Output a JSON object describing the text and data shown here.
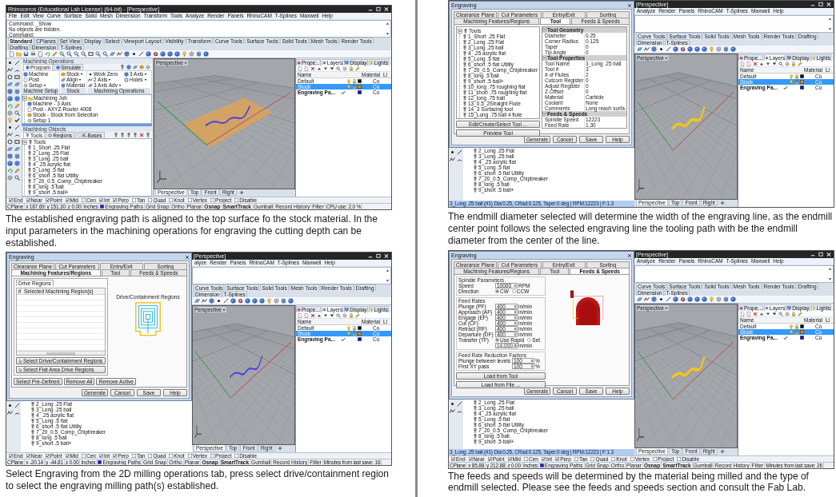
{
  "panels": [
    {
      "screenshot": {
        "title": "Rhinoceros (Educational Lab License) (64-bit) - [Perspective]",
        "menu": [
          "File",
          "Edit",
          "View",
          "Curve",
          "Surface",
          "Solid",
          "Mesh",
          "Dimension",
          "Transform",
          "Tools",
          "Analyze",
          "Render",
          "Panels",
          "RhinoCAM",
          "T-Splines",
          "Maxwell",
          "Help"
        ],
        "command_lines": [
          "Command: _Show",
          "No objects are hidden.",
          "Command:"
        ],
        "toolbar_tabs": [
          {
            "label": "Standard",
            "selected": true
          },
          {
            "label": "CPlanes",
            "selected": false
          },
          {
            "label": "Set View",
            "selected": false
          },
          {
            "label": "Display",
            "selected": false
          },
          {
            "label": "Select",
            "selected": false
          },
          {
            "label": "Viewport Layout",
            "selected": false
          },
          {
            "label": "Visibility",
            "selected": false
          },
          {
            "label": "Transform",
            "selected": false
          },
          {
            "label": "Curve Tools",
            "selected": false
          },
          {
            "label": "Surface Tools",
            "selected": false
          },
          {
            "label": "Solid Tools",
            "selected": false
          },
          {
            "label": "Mesh Tools",
            "selected": false
          },
          {
            "label": "Render Tools",
            "selected": false
          },
          {
            "label": "Drafting",
            "selected": false
          },
          {
            "label": "Dimension",
            "selected": false
          },
          {
            "label": "T-Splines",
            "selected": false
          }
        ],
        "ops_panel": {
          "title": "Machining Operations",
          "tabs": [
            {
              "label": "Program",
              "selected": true
            },
            {
              "label": "Simulate",
              "selected": false
            }
          ],
          "groups": [
            {
              "label": "Machine Setup",
              "buttons": [
                {
                  "label": "Machine",
                  "dropdown": false
                },
                {
                  "label": "Post",
                  "dropdown": false
                },
                {
                  "label": "Setup",
                  "dropdown": true
                }
              ]
            },
            {
              "label": "Stock",
              "buttons": [
                {
                  "label": "Stock",
                  "dropdown": true
                },
                {
                  "label": "Align",
                  "dropdown": true
                },
                {
                  "label": "Material",
                  "dropdown": false
                }
              ]
            },
            {
              "label": "Machining Operations",
              "buttons": [
                {
                  "label": "Work Zero",
                  "dropdown": false
                },
                {
                  "label": "2 Axis",
                  "dropdown": true
                },
                {
                  "label": "3 Axis Adv",
                  "dropdown": true
                },
                {
                  "label": "3 Axis",
                  "dropdown": true
                },
                {
                  "label": "Holes",
                  "dropdown": true
                }
              ]
            }
          ],
          "tree": {
            "label": "Machining Job",
            "expanded": true,
            "children": [
              {
                "label": "Machine - 3 Axis"
              },
              {
                "label": "Post - AXYZ-Router 4008"
              },
              {
                "label": "Stock - Stock from Selection"
              },
              {
                "label": "Setup 1"
              }
            ]
          }
        },
        "objects_panel": {
          "title": "Machining Objects",
          "tabs": [
            {
              "label": "Tools",
              "selected": true
            },
            {
              "label": "Regions",
              "selected": false
            },
            {
              "label": "K-Bases",
              "selected": false
            }
          ],
          "tree": {
            "label": "Tools",
            "expanded": true,
            "children": [
              {
                "label": "1_Short .25 Flat"
              },
              {
                "label": "2_Long .25 Flat"
              },
              {
                "label": "3_Long .25 ball"
              },
              {
                "label": "4_.25 acrylic flat"
              },
              {
                "label": "5_Long .5 flat"
              },
              {
                "label": "6_short .5 flat Utility"
              },
              {
                "label": "7_20_0.5_Comp_Chipbreaker"
              },
              {
                "label": "8_long .5 ball"
              },
              {
                "label": "9_short .5 ball+"
              }
            ]
          }
        },
        "viewport": {
          "label": "Perspective",
          "stock_visible": true,
          "curve_selected": false
        },
        "layers": {
          "tabs": [
            {
              "label": "Prope...",
              "selected": false
            },
            {
              "label": "Layers",
              "selected": true
            },
            {
              "label": "Display",
              "selected": false
            },
            {
              "label": "Lights",
              "selected": false
            }
          ],
          "columns": [
            "Name",
            "Material",
            "Li"
          ],
          "rows": [
            {
              "name": "Default",
              "selected": false,
              "current": false,
              "color": "#000000",
              "linetype": "Co"
            },
            {
              "name": "Stock",
              "selected": true,
              "current": false,
              "color": "#ff8c00",
              "linetype": "Co"
            },
            {
              "name": "Engraving Pa...",
              "selected": false,
              "current": true,
              "color": "#0000ff",
              "linetype": "Co"
            }
          ]
        },
        "viewport_tabs": [
          {
            "label": "Perspective",
            "selected": true
          },
          {
            "label": "Top",
            "selected": false
          },
          {
            "label": "Front",
            "selected": false
          },
          {
            "label": "Right",
            "selected": false
          }
        ],
        "osnap": [
          {
            "label": "End",
            "checked": true
          },
          {
            "label": "Near",
            "checked": true
          },
          {
            "label": "Point",
            "checked": true
          },
          {
            "label": "Mid",
            "checked": true
          },
          {
            "label": "Cen",
            "checked": false
          },
          {
            "label": "Int",
            "checked": true
          },
          {
            "label": "Perp",
            "checked": true
          },
          {
            "label": "Tan",
            "checked": false
          },
          {
            "label": "Quad",
            "checked": false
          },
          {
            "label": "Knot",
            "checked": false
          },
          {
            "label": "Vertex",
            "checked": false
          },
          {
            "label": "Project",
            "checked": false
          },
          {
            "label": "Disable",
            "checked": false
          }
        ],
        "status": [
          {
            "kind": "text",
            "text": "CPlane"
          },
          {
            "kind": "text",
            "text": "x 187.69"
          },
          {
            "kind": "text",
            "text": "y 151.30"
          },
          {
            "kind": "text",
            "text": "z 0.00"
          },
          {
            "kind": "text",
            "text": "Inches"
          },
          {
            "kind": "layer",
            "text": "Engraving Paths"
          },
          {
            "kind": "toggle",
            "text": "Grid Snap",
            "on": false
          },
          {
            "kind": "toggle",
            "text": "Ortho",
            "on": false
          },
          {
            "kind": "toggle",
            "text": "Planar",
            "on": false
          },
          {
            "kind": "toggle",
            "text": "Osnap",
            "on": true
          },
          {
            "kind": "toggle",
            "text": "SmartTrack",
            "on": true
          },
          {
            "kind": "toggle",
            "text": "Gumball",
            "on": false
          },
          {
            "kind": "toggle",
            "text": "Record History",
            "on": false
          },
          {
            "kind": "toggle",
            "text": "Filter",
            "on": false
          },
          {
            "kind": "text",
            "text": "CPU use: 2.0 %"
          }
        ]
      },
      "caption": "The established engraving path is aligned to the top surface fo the stock material. In the input parameters in the machining operations for engraving the cutting depth can be established."
    },
    {
      "screenshot": {
        "title": "[Perspective]",
        "menu": [
          "alyze",
          "Render",
          "Panels",
          "RhinoCAM",
          "T-Splines",
          "Maxwell",
          "Help"
        ],
        "toolbar_tabs": [
          {
            "label": "Curve Tools",
            "selected": false
          },
          {
            "label": "Surface Tools",
            "selected": false
          },
          {
            "label": "Solid Tools",
            "selected": false
          },
          {
            "label": "Mesh Tools",
            "selected": false
          },
          {
            "label": "Render Tools",
            "selected": false
          },
          {
            "label": "Drafting",
            "selected": false
          },
          {
            "label": "Dimension",
            "selected": false
          },
          {
            "label": "T-Splines",
            "selected": false
          }
        ],
        "dialog": {
          "title": "Engraving",
          "tab_rows": [
            [
              {
                "label": "Clearance Plane",
                "selected": false
              },
              {
                "label": "Cut Parameters",
                "selected": false
              },
              {
                "label": "Entry/Exit",
                "selected": false
              },
              {
                "label": "Sorting",
                "selected": false
              }
            ],
            [
              {
                "label": "Machining Features/Regions",
                "selected": true
              },
              {
                "label": "Tool",
                "selected": false
              },
              {
                "label": "Feeds & Speeds",
                "selected": false
              }
            ]
          ],
          "page": {
            "kind": "regions",
            "group": "Drive Regions",
            "columns": [
              "#",
              "Selected Machining Region(s)"
            ],
            "diagram_label": "Drive/Containment Regions",
            "select_buttons": [
              "Select Drive/Containment Regions",
              "Select Flat Area Drive Regions"
            ],
            "action_buttons": [
              "Select Pre-Defined",
              "Remove All",
              "Remove Active"
            ]
          },
          "buttons": [
            "Generate",
            "Cancel",
            "Save",
            "Help"
          ]
        },
        "tools_list": [
          "2_Long .25 Flat",
          "3_Long .25 ball",
          "4_.25 acrylic flat",
          "5_Long .5 flat",
          "6_short .5 flat Utility",
          "7_20_0.5_Comp_Chipbreaker",
          "8_long .5 ball",
          "9_short .5 ball+"
        ],
        "viewport": {
          "label": "Perspective",
          "stock_visible": false,
          "curve_selected": false
        },
        "layers": {
          "tabs": [
            {
              "label": "Prope...",
              "selected": false
            },
            {
              "label": "Layers",
              "selected": true
            },
            {
              "label": "Display",
              "selected": false
            },
            {
              "label": "Lights",
              "selected": false
            }
          ],
          "columns": [
            "Name",
            "Material",
            "Li"
          ],
          "rows": [
            {
              "name": "Default",
              "selected": false,
              "current": false,
              "color": "#000000",
              "linetype": "Co"
            },
            {
              "name": "Stock",
              "selected": true,
              "current": false,
              "color": "#ff8c00",
              "linetype": "Co"
            },
            {
              "name": "Engraving Pa...",
              "selected": false,
              "current": true,
              "color": "#0000ff",
              "linetype": "Co"
            }
          ]
        },
        "viewport_tabs": [
          {
            "label": "Perspective",
            "selected": true
          },
          {
            "label": "Top",
            "selected": false
          },
          {
            "label": "Front",
            "selected": false
          },
          {
            "label": "Right",
            "selected": false
          }
        ],
        "osnap": [
          {
            "label": "End",
            "checked": true
          },
          {
            "label": "Near",
            "checked": true
          },
          {
            "label": "Point",
            "checked": true
          },
          {
            "label": "Mid",
            "checked": true
          },
          {
            "label": "Cen",
            "checked": false
          },
          {
            "label": "Int",
            "checked": true
          },
          {
            "label": "Perp",
            "checked": true
          },
          {
            "label": "Tan",
            "checked": false
          },
          {
            "label": "Quad",
            "checked": false
          },
          {
            "label": "Knot",
            "checked": false
          },
          {
            "label": "Vertex",
            "checked": false
          },
          {
            "label": "Project",
            "checked": false
          },
          {
            "label": "Disable",
            "checked": false
          }
        ],
        "status": [
          {
            "kind": "text",
            "text": "CPlane"
          },
          {
            "kind": "text",
            "text": "x -20.14"
          },
          {
            "kind": "text",
            "text": "y -44.81"
          },
          {
            "kind": "text",
            "text": "z 0.00"
          },
          {
            "kind": "text",
            "text": "Inches"
          },
          {
            "kind": "layer",
            "text": "Engraving Paths"
          },
          {
            "kind": "toggle",
            "text": "Grid Snap",
            "on": false
          },
          {
            "kind": "toggle",
            "text": "Ortho",
            "on": false
          },
          {
            "kind": "toggle",
            "text": "Planar",
            "on": false
          },
          {
            "kind": "toggle",
            "text": "Osnap",
            "on": true
          },
          {
            "kind": "toggle",
            "text": "SmartTrack",
            "on": true
          },
          {
            "kind": "toggle",
            "text": "Gumball",
            "on": false
          },
          {
            "kind": "toggle",
            "text": "Record History",
            "on": false
          },
          {
            "kind": "toggle",
            "text": "Filter",
            "on": false
          },
          {
            "kind": "text",
            "text": "Minutes from last save: 16"
          }
        ]
      },
      "caption": "Select Engraving from the 2D milling operations tab, press select drive/containment region to select the engraving milling path(s) established."
    },
    {
      "screenshot": {
        "title": "[Perspective]",
        "menu": [
          "Analyze",
          "Render",
          "Panels",
          "RhinoCAM",
          "T-Splines",
          "Maxwell",
          "Help"
        ],
        "toolbar_tabs": [
          {
            "label": "Curve Tools",
            "selected": false
          },
          {
            "label": "Surface Tools",
            "selected": false
          },
          {
            "label": "Solid Tools",
            "selected": false
          },
          {
            "label": "Mesh Tools",
            "selected": false
          },
          {
            "label": "Render Tools",
            "selected": false
          },
          {
            "label": "Drafting",
            "selected": false
          },
          {
            "label": "Dimension",
            "selected": false
          },
          {
            "label": "T-Splines",
            "selected": false
          }
        ],
        "dialog": {
          "title": "Engraving",
          "tab_rows": [
            [
              {
                "label": "Clearance Plane",
                "selected": false
              },
              {
                "label": "Cut Parameters",
                "selected": false
              },
              {
                "label": "Entry/Exit",
                "selected": false
              },
              {
                "label": "Sorting",
                "selected": false
              }
            ],
            [
              {
                "label": "Machining Features/Regions",
                "selected": false
              },
              {
                "label": "Tool",
                "selected": true
              },
              {
                "label": "Feeds & Speeds",
                "selected": false
              }
            ]
          ],
          "page": {
            "kind": "tool",
            "tree": {
              "label": "Tools",
              "expanded": true,
              "children": [
                {
                  "label": "1_Short .25 Flat"
                },
                {
                  "label": "2_Long .25 Flat"
                },
                {
                  "label": "3_Long .25 ball"
                },
                {
                  "label": "4_.25 acrylic flat"
                },
                {
                  "label": "5_Long .5 flat"
                },
                {
                  "label": "6_short .5 flat Utility"
                },
                {
                  "label": "7_20_0.5_Comp_Chipbreaker"
                },
                {
                  "label": "8_long .5 ball"
                },
                {
                  "label": "9_short .5 ball+"
                },
                {
                  "label": "10_long .75 roughing flat"
                },
                {
                  "label": "11_short .75 roughing flat"
                },
                {
                  "label": "12_long .75 ball"
                },
                {
                  "label": "13_0.5_2Straight Flute"
                },
                {
                  "label": "14_3 Surfacing tool"
                },
                {
                  "label": "15_Long .75 ball 4 flute"
                }
              ]
            },
            "property_groups": [
              {
                "label": "Tool Geometry",
                "rows": [
                  {
                    "name": "Diameter",
                    "value": "0.25"
                  },
                  {
                    "name": "Corner Radius",
                    "value": "0.125"
                  },
                  {
                    "name": "Taper",
                    "value": "0"
                  },
                  {
                    "name": "Tip Angle",
                    "value": "0"
                  }
                ]
              },
              {
                "label": "Tool Properties",
                "rows": [
                  {
                    "name": "Tool Name",
                    "value": "3_Long .25 ball"
                  },
                  {
                    "name": "Tool #",
                    "value": "3"
                  },
                  {
                    "name": "# of Flutes",
                    "value": "2"
                  },
                  {
                    "name": "Cutcom Register",
                    "value": "0"
                  },
                  {
                    "name": "Adjust Register",
                    "value": "0"
                  },
                  {
                    "name": "Z-Offset",
                    "value": "0"
                  },
                  {
                    "name": "Material",
                    "value": "Carbide"
                  },
                  {
                    "name": "Coolant",
                    "value": "None"
                  },
                  {
                    "name": "Comments",
                    "value": "Long reach surfa"
                  }
                ]
              },
              {
                "label": "Feeds & Speeds",
                "rows": [
                  {
                    "name": "Spindle Speed",
                    "value": "12223"
                  },
                  {
                    "name": "Feed Rate",
                    "value": "1.30"
                  }
                ]
              }
            ],
            "buttons": [
              "Edit/Create/Select Tool ...",
              "Preview Tool"
            ]
          },
          "buttons": [
            "Generate",
            "Cancel",
            "Save",
            "Help"
          ]
        },
        "tools_list": [
          "2_Long .25 Flat",
          "3_Long .25 ball",
          "4_.25 acrylic flat",
          "5_Long .5 flat",
          "6_short .5 flat Utility",
          "7_20_0.5_Comp_Chipbreaker",
          "8_long .5 ball",
          "9_short .5 ball+"
        ],
        "tool_status": "3_Long .25 ball (#1) Dia:0.25, CRad:0.125, Taper:0 deg | RPM:12223 | F:1.3",
        "viewport": {
          "label": "Perspective",
          "stock_visible": false,
          "curve_selected": true
        },
        "layers": {
          "tabs": [
            {
              "label": "Prope...",
              "selected": false
            },
            {
              "label": "Layers",
              "selected": true
            },
            {
              "label": "Display",
              "selected": false
            },
            {
              "label": "Lights",
              "selected": false
            }
          ],
          "columns": [
            "Name",
            "Material",
            "Li"
          ],
          "rows": [
            {
              "name": "Default",
              "selected": false,
              "current": false,
              "color": "#000000",
              "linetype": "Co"
            },
            {
              "name": "Stock",
              "selected": true,
              "current": false,
              "color": "#ff8c00",
              "linetype": "Co"
            },
            {
              "name": "Engraving Pa...",
              "selected": false,
              "current": true,
              "color": "#0000ff",
              "linetype": "Co"
            }
          ]
        },
        "viewport_tabs": [
          {
            "label": "Perspective",
            "selected": true
          },
          {
            "label": "Top",
            "selected": false
          },
          {
            "label": "Front",
            "selected": false
          },
          {
            "label": "Right",
            "selected": false
          }
        ]
      },
      "caption": "The endmill diameter selected will determine the width of the engraving line, as the endmill center point follows the selected engraving line the tooling path with be the endmill diameter from the center of the line."
    },
    {
      "screenshot": {
        "title": "[Perspective]",
        "menu": [
          "Analyze",
          "Render",
          "Panels",
          "RhinoCAM",
          "T-Splines",
          "Maxwell",
          "Help"
        ],
        "toolbar_tabs": [
          {
            "label": "Curve Tools",
            "selected": false
          },
          {
            "label": "Surface Tools",
            "selected": false
          },
          {
            "label": "Solid Tools",
            "selected": false
          },
          {
            "label": "Mesh Tools",
            "selected": false
          },
          {
            "label": "Render Tools",
            "selected": false
          },
          {
            "label": "Drafting",
            "selected": false
          },
          {
            "label": "Dimension",
            "selected": false
          },
          {
            "label": "T-Splines",
            "selected": false
          }
        ],
        "dialog": {
          "title": "Engraving",
          "tab_rows": [
            [
              {
                "label": "Clearance Plane",
                "selected": false
              },
              {
                "label": "Cut Parameters",
                "selected": false
              },
              {
                "label": "Entry/Exit",
                "selected": false
              },
              {
                "label": "Sorting",
                "selected": false
              }
            ],
            [
              {
                "label": "Machining Features/Regions",
                "selected": false
              },
              {
                "label": "Tool",
                "selected": false
              },
              {
                "label": "Feeds & Speeds",
                "selected": true
              }
            ]
          ],
          "page": {
            "kind": "feeds",
            "spindle": {
              "title": "Spindle Parameters",
              "speed": {
                "label": "Speed",
                "value": "10000",
                "unit": "RPM"
              },
              "direction": {
                "label": "Direction",
                "options": [
                  {
                    "label": "CW",
                    "selected": true
                  },
                  {
                    "label": "CCW",
                    "selected": false
                  }
                ]
              }
            },
            "feed_rates": {
              "title": "Feed Rates",
              "rows": [
                {
                  "label": "Plunge (PF)",
                  "value": "400",
                  "unit": "in/min"
                },
                {
                  "label": "Approach (AF)",
                  "value": "400",
                  "unit": "in/min"
                },
                {
                  "label": "Engage (EF)",
                  "value": "400",
                  "unit": "in/min"
                },
                {
                  "label": "Cut (CF)",
                  "value": "400",
                  "unit": "in/min"
                },
                {
                  "label": "Retract (RF)",
                  "value": "400",
                  "unit": "in/min"
                },
                {
                  "label": "Departure (DF)",
                  "value": "400",
                  "unit": "in/min"
                }
              ],
              "transfer": {
                "label": "Transfer (TF)",
                "options": [
                  {
                    "label": "Use Rapid",
                    "selected": true
                  },
                  {
                    "label": "Set",
                    "selected": false
                  }
                ],
                "value": "14.000",
                "unit": "in/min",
                "disabled": true
              }
            },
            "reduction": {
              "title": "Feed Rate Reduction Factors",
              "rows": [
                {
                  "label": "Plunge between levels",
                  "value": "100",
                  "unit": "%"
                },
                {
                  "label": "First XY pass",
                  "value": "100",
                  "unit": "%"
                }
              ]
            },
            "buttons": [
              "Load from Tool",
              "Load from File ..."
            ]
          },
          "buttons": [
            "Generate",
            "Cancel",
            "Save",
            "Help"
          ]
        },
        "tools_list": [
          "2_Long .25 Flat",
          "3_Long .25 ball",
          "4_.25 acrylic flat",
          "5_Long .5 flat",
          "6_short .5 flat Utility",
          "7_20_0.5_Comp_Chipbreaker",
          "8_long .5 ball",
          "9_short .5 ball+"
        ],
        "tool_status": "3_Long .25 ball (#1) Dia:0.25, CRad:0.125, Taper:0 deg | RPM:12223 | F:1.3",
        "viewport": {
          "label": "Perspective",
          "stock_visible": false,
          "curve_selected": true
        },
        "layers": {
          "tabs": [
            {
              "label": "Prope...",
              "selected": false
            },
            {
              "label": "Layers",
              "selected": true
            },
            {
              "label": "Display",
              "selected": false
            },
            {
              "label": "Lights",
              "selected": false
            }
          ],
          "columns": [
            "Name",
            "Material",
            "Li"
          ],
          "rows": [
            {
              "name": "Default",
              "selected": false,
              "current": false,
              "color": "#000000",
              "linetype": "Co"
            },
            {
              "name": "Stock",
              "selected": true,
              "current": false,
              "color": "#ff8c00",
              "linetype": "Co"
            },
            {
              "name": "Engraving Pa...",
              "selected": false,
              "current": true,
              "color": "#0000ff",
              "linetype": "Co"
            }
          ]
        },
        "viewport_tabs": [
          {
            "label": "Perspective",
            "selected": true
          },
          {
            "label": "Top",
            "selected": false
          },
          {
            "label": "Front",
            "selected": false
          },
          {
            "label": "Right",
            "selected": false
          }
        ],
        "osnap": [
          {
            "label": "End",
            "checked": true
          },
          {
            "label": "Near",
            "checked": true
          },
          {
            "label": "Point",
            "checked": true
          },
          {
            "label": "Mid",
            "checked": true
          },
          {
            "label": "Cen",
            "checked": false
          },
          {
            "label": "Int",
            "checked": true
          },
          {
            "label": "Perp",
            "checked": true
          },
          {
            "label": "Tan",
            "checked": false
          },
          {
            "label": "Quad",
            "checked": false
          },
          {
            "label": "Knot",
            "checked": false
          },
          {
            "label": "Vertex",
            "checked": false
          },
          {
            "label": "Project",
            "checked": false
          },
          {
            "label": "Disable",
            "checked": false
          }
        ],
        "status": [
          {
            "kind": "text",
            "text": "CPlane"
          },
          {
            "kind": "text",
            "text": "x 85.88"
          },
          {
            "kind": "text",
            "text": "y 212.88"
          },
          {
            "kind": "text",
            "text": "z 0.00"
          },
          {
            "kind": "text",
            "text": "Inches"
          },
          {
            "kind": "layer",
            "text": "Engraving Paths"
          },
          {
            "kind": "toggle",
            "text": "Grid Snap",
            "on": false
          },
          {
            "kind": "toggle",
            "text": "Ortho",
            "on": false
          },
          {
            "kind": "toggle",
            "text": "Planar",
            "on": false
          },
          {
            "kind": "toggle",
            "text": "Osnap",
            "on": true
          },
          {
            "kind": "toggle",
            "text": "SmartTrack",
            "on": true
          },
          {
            "kind": "toggle",
            "text": "Gumball",
            "on": false
          },
          {
            "kind": "toggle",
            "text": "Record History",
            "on": false
          },
          {
            "kind": "toggle",
            "text": "Filter",
            "on": false
          },
          {
            "kind": "text",
            "text": "Minutes from last save: 26"
          }
        ]
      },
      "caption": "The feeds and speeds will be determined by the material being milled and the type of endmill selected. Please see the feeds and speeds section and consult the Fab Lab."
    }
  ]
}
